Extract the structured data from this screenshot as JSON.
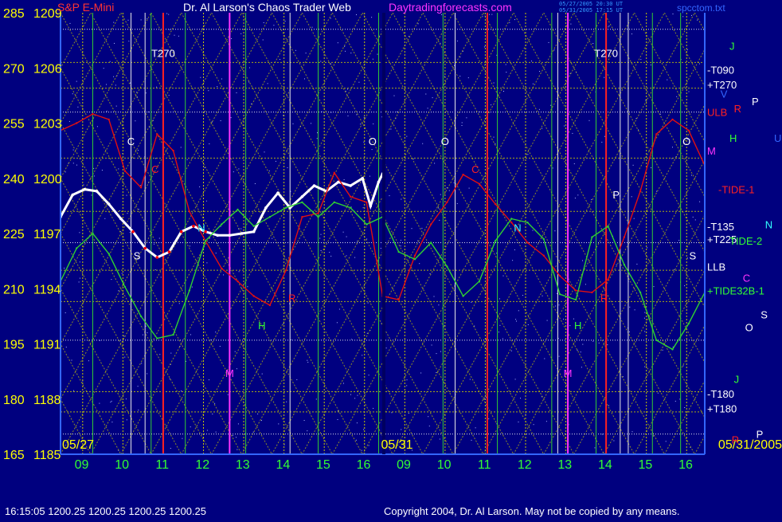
{
  "header": {
    "instrument": "S&P E-Mini",
    "title": "Dr. Al Larson's Chaos Trader Web",
    "site": "Daytradingforecasts.com",
    "stamp_1": "05/27/2005 20:30 UT",
    "stamp_2": "05/31/2005 17:15 UT",
    "file": "spcctom.txt"
  },
  "footer": {
    "quote": "16:15:05  1200.25 1200.25 1200.25 1200.25",
    "copyright": "Copyright 2004, Dr. Al Larson. May not be copied by any means."
  },
  "colors": {
    "background": "#00007f",
    "axis_yellow": "#ffff00",
    "title_white": "#ffffff",
    "site_magenta": "#ff33ff",
    "instrument_red": "#ff3333",
    "xlabel_green": "#33ff33",
    "grid_yellow": "#c8c800",
    "grid_green": "#33cc33",
    "price_white": "#ffffff",
    "price_red": "#ff0000",
    "tide_red": "#e01010",
    "tide_green": "#30d030"
  },
  "chart_data": {
    "type": "line",
    "ylim": [
      1185,
      1209
    ],
    "y_ticks": [
      {
        "left": "285",
        "right": "1209",
        "value": 1209
      },
      {
        "left": "270",
        "right": "1206",
        "value": 1206
      },
      {
        "left": "255",
        "right": "1203",
        "value": 1203
      },
      {
        "left": "240",
        "right": "1200",
        "value": 1200
      },
      {
        "left": "225",
        "right": "1197",
        "value": 1197
      },
      {
        "left": "210",
        "right": "1194",
        "value": 1194
      },
      {
        "left": "195",
        "right": "1191",
        "value": 1191
      },
      {
        "left": "180",
        "right": "1188",
        "value": 1188
      },
      {
        "left": "165",
        "right": "1185",
        "value": 1185
      }
    ],
    "xlim": [
      0,
      16
    ],
    "x_ticks": [
      {
        "label": "09",
        "x": 1
      },
      {
        "label": "10",
        "x": 2
      },
      {
        "label": "11",
        "x": 3
      },
      {
        "label": "12",
        "x": 4
      },
      {
        "label": "13",
        "x": 5
      },
      {
        "label": "14",
        "x": 6
      },
      {
        "label": "15",
        "x": 7
      },
      {
        "label": "16",
        "x": 8
      },
      {
        "label": "09",
        "x": 9
      },
      {
        "label": "10",
        "x": 10
      },
      {
        "label": "11",
        "x": 11
      },
      {
        "label": "12",
        "x": 12
      },
      {
        "label": "13",
        "x": 13
      },
      {
        "label": "14",
        "x": 14
      },
      {
        "label": "15",
        "x": 15
      },
      {
        "label": "16",
        "x": 16
      }
    ],
    "date_labels": [
      {
        "text": "05/27",
        "x": 0
      },
      {
        "text": "05/31",
        "x": 8
      },
      {
        "text": "05/31/2005",
        "x": 16
      }
    ],
    "grid": {
      "yellow_verticals": [
        0.55,
        1.55,
        2.55,
        3.55,
        4.55,
        5.55,
        6.55,
        7.55,
        8.55,
        9.55,
        10.55,
        11.55,
        12.55,
        13.55,
        14.55,
        15.55
      ],
      "green_verticals": [
        0.8,
        2.25,
        3.1,
        4.6,
        6.4,
        7.9,
        9.5,
        10.85,
        12.2,
        13.3,
        14.7,
        15.4
      ],
      "red_verticals": [
        2.55,
        10.6,
        13.55
      ],
      "white_verticals": [
        1.75,
        2.1,
        5.7,
        9.8,
        12.35,
        13.9,
        14.1
      ],
      "magenta_verticals": [
        4.2,
        12.6
      ],
      "horizontal_levels": [
        1208.1,
        1206.3,
        1204.9,
        1203.6,
        1201.1,
        1198.2,
        1196.5,
        1195.0,
        1193.3,
        1191.2,
        1188.4,
        1187.3,
        1186.1
      ]
    },
    "series": [
      {
        "role": "price",
        "x": [
          0.0,
          0.3,
          0.6,
          0.9,
          1.2,
          1.5,
          1.8,
          2.1,
          2.4,
          2.7,
          3.0,
          3.3,
          3.6,
          3.9,
          4.2,
          4.5,
          4.8,
          5.1,
          5.4,
          5.7,
          6.0,
          6.3,
          6.6,
          6.9,
          7.2,
          7.5,
          7.7,
          7.9,
          8.0
        ],
        "y": [
          1197.9,
          1199.1,
          1199.4,
          1199.3,
          1198.6,
          1197.8,
          1197.1,
          1196.2,
          1195.7,
          1196.0,
          1197.1,
          1197.4,
          1197.1,
          1196.9,
          1196.9,
          1197.0,
          1197.1,
          1198.4,
          1199.2,
          1198.4,
          1199.0,
          1199.6,
          1199.3,
          1199.8,
          1199.6,
          1200.0,
          1198.5,
          1199.8,
          1200.25
        ]
      },
      {
        "role": "red-tide",
        "x": [
          0.0,
          0.4,
          0.8,
          1.2,
          1.6,
          2.0,
          2.4,
          2.8,
          3.2,
          3.6,
          4.0,
          4.4,
          4.8,
          5.2,
          5.6,
          6.0,
          6.4,
          6.8,
          7.2,
          7.6,
          8.0,
          8.4,
          8.8,
          9.2,
          9.6,
          10.0,
          10.4,
          10.8,
          11.2,
          11.6,
          12.0,
          12.4,
          12.8,
          13.2,
          13.6,
          14.0,
          14.4,
          14.8,
          15.2,
          15.6,
          16.0
        ],
        "y": [
          1202.6,
          1203.0,
          1203.5,
          1203.2,
          1200.4,
          1199.5,
          1202.4,
          1201.5,
          1198.2,
          1196.6,
          1195.1,
          1194.4,
          1193.6,
          1193.1,
          1195.0,
          1197.9,
          1198.1,
          1200.3,
          1199.0,
          1198.7,
          1193.6,
          1193.4,
          1195.8,
          1197.5,
          1198.7,
          1200.2,
          1199.7,
          1198.6,
          1197.6,
          1196.5,
          1195.8,
          1194.7,
          1193.9,
          1193.8,
          1194.5,
          1196.8,
          1199.3,
          1202.4,
          1203.2,
          1202.6,
          1200.7
        ]
      },
      {
        "role": "green-tide",
        "x": [
          0.0,
          0.4,
          0.8,
          1.2,
          1.6,
          2.0,
          2.4,
          2.8,
          3.2,
          3.6,
          4.0,
          4.4,
          4.8,
          5.2,
          5.6,
          6.0,
          6.4,
          6.8,
          7.2,
          7.6,
          8.0,
          8.4,
          8.8,
          9.2,
          9.6,
          10.0,
          10.4,
          10.8,
          11.2,
          11.6,
          12.0,
          12.4,
          12.8,
          13.2,
          13.6,
          14.0,
          14.4,
          14.8,
          15.2,
          15.6,
          16.0
        ],
        "y": [
          1194.4,
          1196.2,
          1197.0,
          1195.9,
          1194.1,
          1192.5,
          1191.3,
          1191.5,
          1193.9,
          1196.6,
          1197.5,
          1198.3,
          1197.4,
          1197.9,
          1198.4,
          1198.7,
          1197.9,
          1198.7,
          1198.4,
          1197.5,
          1197.9,
          1196.0,
          1195.6,
          1196.5,
          1195.2,
          1193.6,
          1194.4,
          1196.6,
          1197.8,
          1197.6,
          1196.7,
          1193.7,
          1193.4,
          1196.8,
          1197.4,
          1195.3,
          1193.8,
          1191.2,
          1190.7,
          1192.1,
          1193.8
        ]
      }
    ],
    "annotations": [
      {
        "text": "T270",
        "x": 2.55,
        "y": 1206.6,
        "color": "#ffffff"
      },
      {
        "text": "T270",
        "x": 13.55,
        "y": 1206.6,
        "color": "#ffffff"
      },
      {
        "text": "C",
        "x": 1.75,
        "y": 1201.8,
        "color": "#ffffff"
      },
      {
        "text": "O",
        "x": 7.75,
        "y": 1201.8,
        "color": "#ffffff"
      },
      {
        "text": "O",
        "x": 9.55,
        "y": 1201.8,
        "color": "#ffffff"
      },
      {
        "text": "O",
        "x": 15.55,
        "y": 1201.8,
        "color": "#ffffff"
      },
      {
        "text": "C",
        "x": 2.35,
        "y": 1200.3,
        "color": "#ff2020"
      },
      {
        "text": "C",
        "x": 10.3,
        "y": 1200.3,
        "color": "#ff2020"
      },
      {
        "text": "N",
        "x": 3.5,
        "y": 1197.1,
        "color": "#33ffff"
      },
      {
        "text": "N",
        "x": 11.35,
        "y": 1197.1,
        "color": "#33ffff"
      },
      {
        "text": "P",
        "x": 13.8,
        "y": 1198.9,
        "color": "#ffffff"
      },
      {
        "text": "H",
        "x": 5.0,
        "y": 1191.8,
        "color": "#33ff33"
      },
      {
        "text": "H",
        "x": 12.85,
        "y": 1191.8,
        "color": "#33ff33"
      },
      {
        "text": "M",
        "x": 4.2,
        "y": 1189.2,
        "color": "#ff33ff"
      },
      {
        "text": "M",
        "x": 12.6,
        "y": 1189.2,
        "color": "#ff33ff"
      },
      {
        "text": "R",
        "x": 5.75,
        "y": 1193.3,
        "color": "#ff2020"
      },
      {
        "text": "R",
        "x": 13.5,
        "y": 1193.3,
        "color": "#ff2020"
      },
      {
        "text": "S",
        "x": 1.9,
        "y": 1195.6,
        "color": "#ffffff"
      },
      {
        "text": "S",
        "x": 15.7,
        "y": 1195.6,
        "color": "#ffffff"
      }
    ],
    "right_labels": [
      {
        "text": "J",
        "y": 1207.2,
        "color": "#33ff33",
        "col": 1
      },
      {
        "text": "-T090",
        "y": 1205.9,
        "color": "#ffffff",
        "col": 0
      },
      {
        "text": "+T270",
        "y": 1205.1,
        "color": "#ffffff",
        "col": 0
      },
      {
        "text": "V",
        "y": 1204.6,
        "color": "#3366ff",
        "col": 0.6
      },
      {
        "text": "P",
        "y": 1204.2,
        "color": "#ffffff",
        "col": 2
      },
      {
        "text": "R",
        "y": 1203.8,
        "color": "#ff2020",
        "col": 1.2
      },
      {
        "text": "ULB",
        "y": 1203.6,
        "color": "#ff2020",
        "col": 0
      },
      {
        "text": "H",
        "y": 1202.2,
        "color": "#33ff33",
        "col": 1
      },
      {
        "text": "U",
        "y": 1202.2,
        "color": "#3366ff",
        "col": 3
      },
      {
        "text": "M",
        "y": 1201.5,
        "color": "#ff33ff",
        "col": 0
      },
      {
        "text": "-TIDE-1",
        "y": 1199.4,
        "color": "#ff2020",
        "col": 0.5
      },
      {
        "text": "-T135",
        "y": 1197.4,
        "color": "#ffffff",
        "col": 0
      },
      {
        "text": "N",
        "y": 1197.5,
        "color": "#33ffff",
        "col": 2.6
      },
      {
        "text": "+T225",
        "y": 1196.7,
        "color": "#ffffff",
        "col": 0
      },
      {
        "text": "TIDE-2",
        "y": 1196.6,
        "color": "#33ff33",
        "col": 1
      },
      {
        "text": "LLB",
        "y": 1195.2,
        "color": "#ffffff",
        "col": 0
      },
      {
        "text": "C",
        "y": 1194.6,
        "color": "#ff33ff",
        "col": 1.6
      },
      {
        "text": "+TIDE32B-1",
        "y": 1193.9,
        "color": "#33ff33",
        "col": 0
      },
      {
        "text": "S",
        "y": 1192.6,
        "color": "#ffffff",
        "col": 2.4
      },
      {
        "text": "O",
        "y": 1191.9,
        "color": "#ffffff",
        "col": 1.7
      },
      {
        "text": "J",
        "y": 1189.1,
        "color": "#33ff33",
        "col": 1.2
      },
      {
        "text": "-T180",
        "y": 1188.3,
        "color": "#ffffff",
        "col": 0
      },
      {
        "text": "+T180",
        "y": 1187.5,
        "color": "#ffffff",
        "col": 0
      },
      {
        "text": "P",
        "y": 1186.1,
        "color": "#ffffff",
        "col": 2.2
      },
      {
        "text": "R",
        "y": 1185.8,
        "color": "#ff2020",
        "col": 1.1
      }
    ]
  }
}
